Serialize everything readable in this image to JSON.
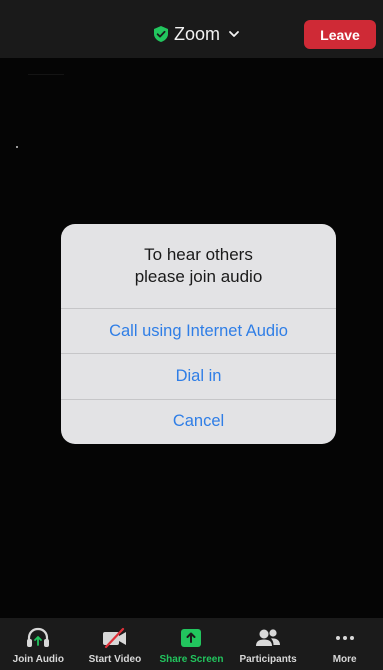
{
  "header": {
    "meeting_title": "Zoom",
    "leave_label": "Leave",
    "shield_icon": "shield-check-icon",
    "chevron_icon": "chevron-down-icon"
  },
  "dialog": {
    "message_line1": "To hear others",
    "message_line2": "please join audio",
    "buttons": [
      {
        "label": "Call using Internet Audio"
      },
      {
        "label": "Dial in"
      },
      {
        "label": "Cancel"
      }
    ]
  },
  "toolbar": {
    "items": [
      {
        "label": "Join Audio",
        "icon": "headphones-icon"
      },
      {
        "label": "Start Video",
        "icon": "video-off-icon"
      },
      {
        "label": "Share Screen",
        "icon": "share-screen-icon"
      },
      {
        "label": "Participants",
        "icon": "participants-icon"
      },
      {
        "label": "More",
        "icon": "more-icon"
      }
    ]
  },
  "colors": {
    "leave": "#cf2a36",
    "shield": "#22c55e",
    "share": "#22c55e",
    "dialog_button_text": "#2f7ee6"
  }
}
